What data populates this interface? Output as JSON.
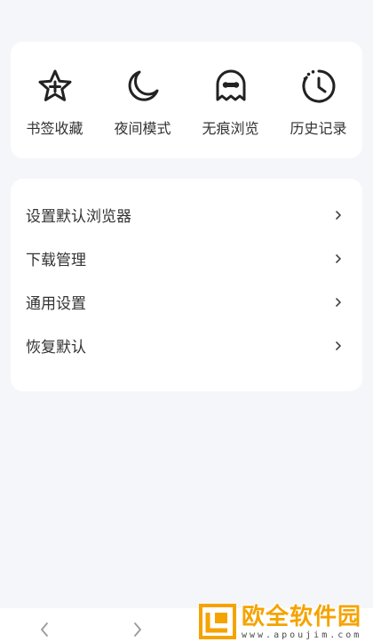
{
  "quick_actions": [
    {
      "label": "书签收藏",
      "icon": "star-plus-icon"
    },
    {
      "label": "夜间模式",
      "icon": "moon-icon"
    },
    {
      "label": "无痕浏览",
      "icon": "ghost-icon"
    },
    {
      "label": "历史记录",
      "icon": "history-clock-icon"
    }
  ],
  "menu": [
    {
      "label": "设置默认浏览器"
    },
    {
      "label": "下载管理"
    },
    {
      "label": "通用设置"
    },
    {
      "label": "恢复默认"
    }
  ],
  "bottom_nav": {
    "back_icon": "chevron-left-icon",
    "forward_icon": "chevron-right-icon"
  },
  "watermark": {
    "brand": "欧全软件园",
    "url": "www.apoujim.com"
  },
  "colors": {
    "background": "#f5f6fa",
    "card": "#ffffff",
    "icon": "#222222",
    "watermark": "#f5a300"
  }
}
